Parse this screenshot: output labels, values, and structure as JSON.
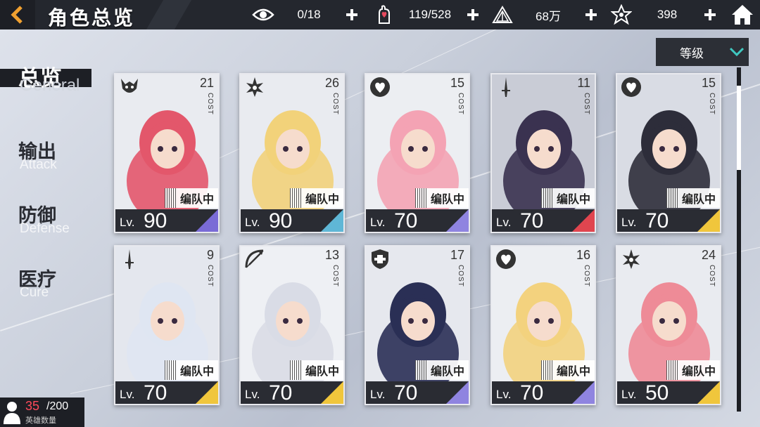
{
  "header": {
    "title": "角色总览",
    "resources": [
      {
        "icon": "eye-icon",
        "value": "0/18"
      },
      {
        "icon": "hand-heart-icon",
        "value": "119/528"
      },
      {
        "icon": "pyramid-icon",
        "value": "68万"
      },
      {
        "icon": "star-icon",
        "value": "398"
      }
    ]
  },
  "sort": {
    "label": "等级"
  },
  "tabs": [
    {
      "cn": "总览",
      "en": "General",
      "active": true
    },
    {
      "cn": "输出",
      "en": "Attack",
      "active": false
    },
    {
      "cn": "防御",
      "en": "Defense",
      "active": false
    },
    {
      "cn": "医疗",
      "en": "Cure",
      "active": false
    }
  ],
  "cost_label": "COST",
  "team_label": "编队中",
  "lv_prefix": "Lv.",
  "cards": [
    {
      "cost": "21",
      "level": "90",
      "class": "demon-icon",
      "accent": "#7a6bd6",
      "hair": "#e3576b",
      "bg": "#e9ebf0"
    },
    {
      "cost": "26",
      "level": "90",
      "class": "spirit-icon",
      "accent": "#5fb7d6",
      "hair": "#f2d27a",
      "bg": "#e9ebf0"
    },
    {
      "cost": "15",
      "level": "70",
      "class": "heart-icon",
      "accent": "#8f84e0",
      "hair": "#f4a3b4",
      "bg": "#eceef2"
    },
    {
      "cost": "11",
      "level": "70",
      "class": "sword-icon",
      "accent": "#e0454f",
      "hair": "#3a3250",
      "bg": "#c9ccd6"
    },
    {
      "cost": "15",
      "level": "70",
      "class": "heart-icon",
      "accent": "#f0c63c",
      "hair": "#2d2d3a",
      "bg": "#d9dce4"
    },
    {
      "cost": "9",
      "level": "70",
      "class": "sword-icon",
      "accent": "#f0c63c",
      "hair": "#dfe6f2",
      "bg": "#e4e7ee"
    },
    {
      "cost": "13",
      "level": "70",
      "class": "bow-icon",
      "accent": "#f0c63c",
      "hair": "#d9dce6",
      "bg": "#eef0f4"
    },
    {
      "cost": "17",
      "level": "70",
      "class": "shield-icon",
      "accent": "#8f84e0",
      "hair": "#2a2f55",
      "bg": "#e6e8ee"
    },
    {
      "cost": "16",
      "level": "70",
      "class": "heart-icon",
      "accent": "#8f84e0",
      "hair": "#f3d27e",
      "bg": "#eceef2"
    },
    {
      "cost": "24",
      "level": "50",
      "class": "spirit-icon",
      "accent": "#f0c63c",
      "hair": "#ee8b97",
      "bg": "#e9ebf0"
    }
  ],
  "hero_count": {
    "current": "35",
    "max": "/200",
    "label": "英雄数量"
  }
}
